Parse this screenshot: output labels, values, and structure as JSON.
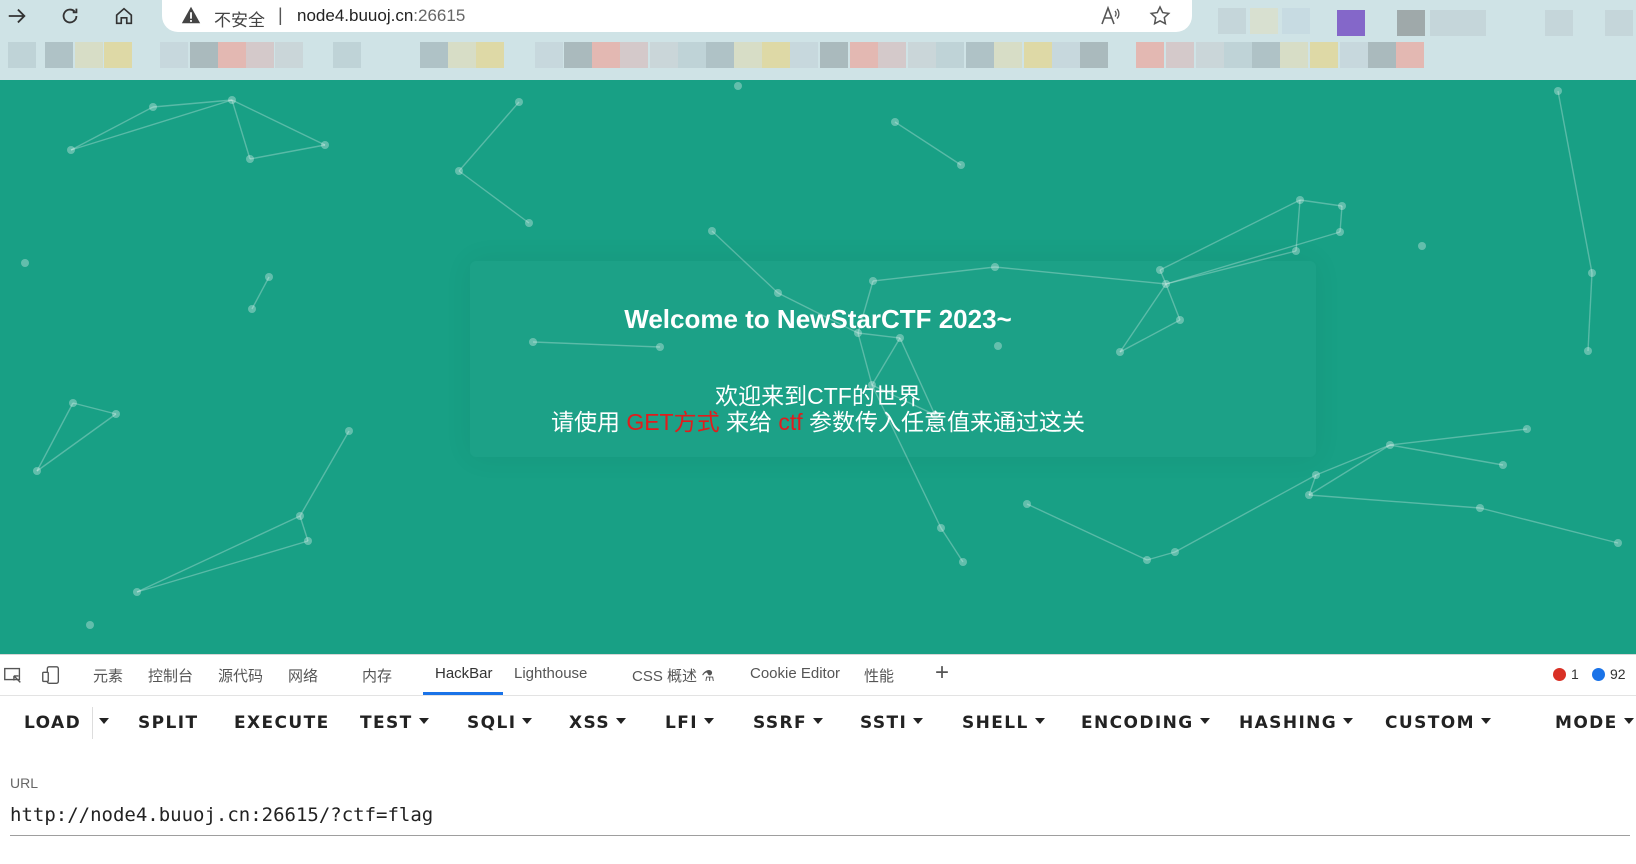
{
  "browser": {
    "security_label": "不安全",
    "separator": "|",
    "url_host": "node4.buuoj.cn",
    "url_port": ":26615"
  },
  "page": {
    "title": "Welcome to NewStarCTF 2023~",
    "line1": "欢迎来到CTF的世界",
    "line2_prefix": "请使用 ",
    "line2_method": "GET方式",
    "line2_mid": " 来给 ",
    "line2_param": "ctf",
    "line2_suffix": " 参数传入任意值来通过这关",
    "background_color": "#18a085",
    "highlight_color": "#e11c1c"
  },
  "devtools": {
    "tabs": [
      "元素",
      "控制台",
      "源代码",
      "网络",
      "内存",
      "HackBar",
      "Lighthouse",
      "CSS 概述",
      "Cookie Editor",
      "性能"
    ],
    "active_tab": "HackBar",
    "error_count": "1",
    "message_count": "92"
  },
  "hackbar": {
    "buttons": [
      "LOAD",
      "SPLIT",
      "EXECUTE",
      "TEST",
      "SQLI",
      "XSS",
      "LFI",
      "SSRF",
      "SSTI",
      "SHELL",
      "ENCODING",
      "HASHING",
      "CUSTOM",
      "MODE"
    ],
    "url_label": "URL",
    "url_value": "http://node4.buuoj.cn:26615/?ctf=flag"
  }
}
